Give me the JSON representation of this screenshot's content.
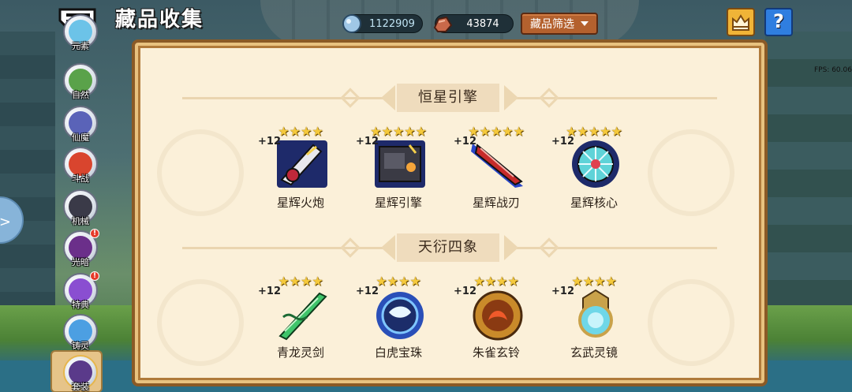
{
  "header": {
    "title": "藏品收集",
    "currency_gem": "1122909",
    "currency_ore": "43874",
    "filter_label": "藏品筛选",
    "help_label": "?"
  },
  "fps": "FPS: 60.06",
  "sidebar": {
    "items": [
      {
        "label": "元素",
        "alert": ""
      },
      {
        "label": "自然",
        "alert": ""
      },
      {
        "label": "仙魔",
        "alert": ""
      },
      {
        "label": "斗战",
        "alert": ""
      },
      {
        "label": "机械",
        "alert": ""
      },
      {
        "label": "光暗",
        "alert": "!"
      },
      {
        "label": "特典",
        "alert": "!"
      },
      {
        "label": "铸灵",
        "alert": ""
      },
      {
        "label": "套装",
        "alert": ""
      }
    ]
  },
  "sections": [
    {
      "title": "恒星引擎",
      "items": [
        {
          "name": "星辉火炮",
          "level": "+12",
          "stars": 4
        },
        {
          "name": "星辉引擎",
          "level": "+12",
          "stars": 5
        },
        {
          "name": "星辉战刃",
          "level": "+12",
          "stars": 5
        },
        {
          "name": "星辉核心",
          "level": "+12",
          "stars": 5
        }
      ]
    },
    {
      "title": "天衍四象",
      "items": [
        {
          "name": "青龙灵剑",
          "level": "+12",
          "stars": 4
        },
        {
          "name": "白虎宝珠",
          "level": "+12",
          "stars": 4
        },
        {
          "name": "朱雀玄铃",
          "level": "+12",
          "stars": 4
        },
        {
          "name": "玄武灵镜",
          "level": "+12",
          "stars": 4
        }
      ]
    }
  ],
  "colors": {
    "accent_gold": "#f5c93b",
    "panel_bg": "#fbf0d9",
    "filter_button": "#b4612e",
    "help_button": "#2f7ee0"
  }
}
